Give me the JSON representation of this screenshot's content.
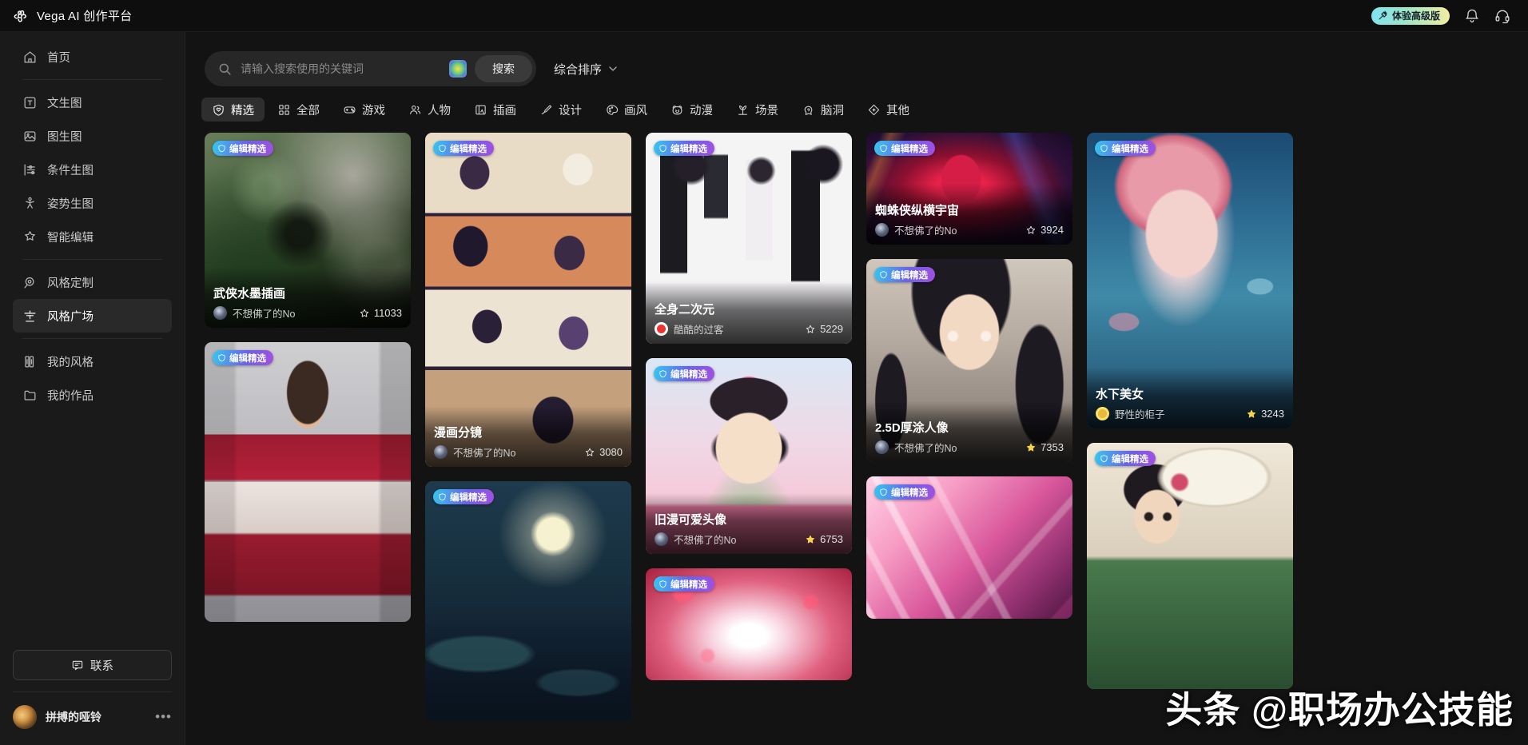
{
  "app": {
    "brand": "Vega AI 创作平台",
    "logo_icon": "vega-flower-logo"
  },
  "header": {
    "premium_label": "体验高级版",
    "premium_gradient_from": "#7fe3f0",
    "premium_gradient_to": "#f3eda0",
    "notification_icon": "bell-icon",
    "support_icon": "headset-icon"
  },
  "sidebar": {
    "items": [
      {
        "label": "首页",
        "icon": "home-icon",
        "active": false
      },
      {
        "label": "文生图",
        "icon": "text-to-image-icon",
        "active": false
      },
      {
        "label": "图生图",
        "icon": "image-to-image-icon",
        "active": false
      },
      {
        "label": "条件生图",
        "icon": "sliders-icon",
        "active": false
      },
      {
        "label": "姿势生图",
        "icon": "pose-icon",
        "active": false
      },
      {
        "label": "智能编辑",
        "icon": "magic-wand-icon",
        "active": false
      },
      {
        "label": "风格定制",
        "icon": "target-icon",
        "active": false
      },
      {
        "label": "风格广场",
        "icon": "plaza-icon",
        "active": true
      },
      {
        "label": "我的风格",
        "icon": "books-icon",
        "active": false
      },
      {
        "label": "我的作品",
        "icon": "folder-icon",
        "active": false
      }
    ],
    "contact": {
      "label": "联系",
      "icon": "message-icon"
    },
    "user": {
      "name": "拼搏的哑铃",
      "more_icon": "more-dots-icon",
      "avatar": "user-avatar"
    }
  },
  "search": {
    "placeholder": "请输入搜索使用的关键词",
    "value": "",
    "icon": "search-icon",
    "camera_icon": "image-search-icon",
    "button_label": "搜索",
    "sort_label": "综合排序",
    "sort_icon": "chevron-down-icon"
  },
  "tabs": [
    {
      "label": "精选",
      "icon": "heart-shield-icon",
      "active": true
    },
    {
      "label": "全部",
      "icon": "grid-icon",
      "active": false
    },
    {
      "label": "游戏",
      "icon": "gamepad-icon",
      "active": false
    },
    {
      "label": "人物",
      "icon": "people-icon",
      "active": false
    },
    {
      "label": "插画",
      "icon": "illustration-icon",
      "active": false
    },
    {
      "label": "设计",
      "icon": "design-pen-icon",
      "active": false
    },
    {
      "label": "画风",
      "icon": "palette-icon",
      "active": false
    },
    {
      "label": "动漫",
      "icon": "anime-face-icon",
      "active": false
    },
    {
      "label": "场景",
      "icon": "scene-grass-icon",
      "active": false
    },
    {
      "label": "脑洞",
      "icon": "brain-idea-icon",
      "active": false
    },
    {
      "label": "其他",
      "icon": "diamond-icon",
      "active": false
    }
  ],
  "badge": {
    "label": "编辑精选",
    "icon": "editor-pick-icon"
  },
  "columns": [
    {
      "cards": [
        {
          "title": "武侠水墨插画",
          "author": "不想佛了的No",
          "stars": "11033",
          "badge": true,
          "star_filled": false,
          "art": "art-wuxia",
          "avatar": "a1"
        },
        {
          "title": "",
          "author": "",
          "stars": "",
          "badge": true,
          "star_filled": false,
          "art": "art-fashion",
          "avatar": "a1"
        }
      ]
    },
    {
      "cards": [
        {
          "title": "漫画分镜",
          "author": "不想佛了的No",
          "stars": "3080",
          "badge": true,
          "star_filled": false,
          "art": "art-comic",
          "avatar": "a1"
        },
        {
          "title": "",
          "author": "",
          "stars": "",
          "badge": true,
          "star_filled": false,
          "art": "art-moon",
          "avatar": "a1"
        }
      ]
    },
    {
      "cards": [
        {
          "title": "全身二次元",
          "author": "酷酷的过客",
          "stars": "5229",
          "badge": true,
          "star_filled": false,
          "art": "art-full2d",
          "avatar": "a2"
        },
        {
          "title": "旧漫可爱头像",
          "author": "不想佛了的No",
          "stars": "6753",
          "badge": true,
          "star_filled": true,
          "art": "art-kawaii",
          "avatar": "a1"
        },
        {
          "title": "",
          "author": "",
          "stars": "",
          "badge": true,
          "star_filled": false,
          "art": "art-fox",
          "avatar": "a1"
        }
      ]
    },
    {
      "cards": [
        {
          "title": "蜘蛛侠纵横宇宙",
          "author": "不想佛了的No",
          "stars": "3924",
          "badge": true,
          "star_filled": false,
          "art": "art-spider",
          "avatar": "a1"
        },
        {
          "title": "2.5D厚涂人像",
          "author": "不想佛了的No",
          "stars": "7353",
          "badge": true,
          "star_filled": true,
          "art": "art-25d",
          "avatar": "a1"
        },
        {
          "title": "",
          "author": "",
          "stars": "",
          "badge": true,
          "star_filled": false,
          "art": "art-crystal",
          "avatar": "a1"
        }
      ]
    },
    {
      "cards": [
        {
          "title": "水下美女",
          "author": "野性的柜子",
          "stars": "3243",
          "badge": true,
          "star_filled": true,
          "art": "art-water",
          "avatar": "a3"
        },
        {
          "title": "",
          "author": "",
          "stars": "",
          "badge": true,
          "star_filled": false,
          "art": "art-umbrella",
          "avatar": "a1"
        }
      ]
    }
  ],
  "watermark": "头条 @职场办公技能"
}
